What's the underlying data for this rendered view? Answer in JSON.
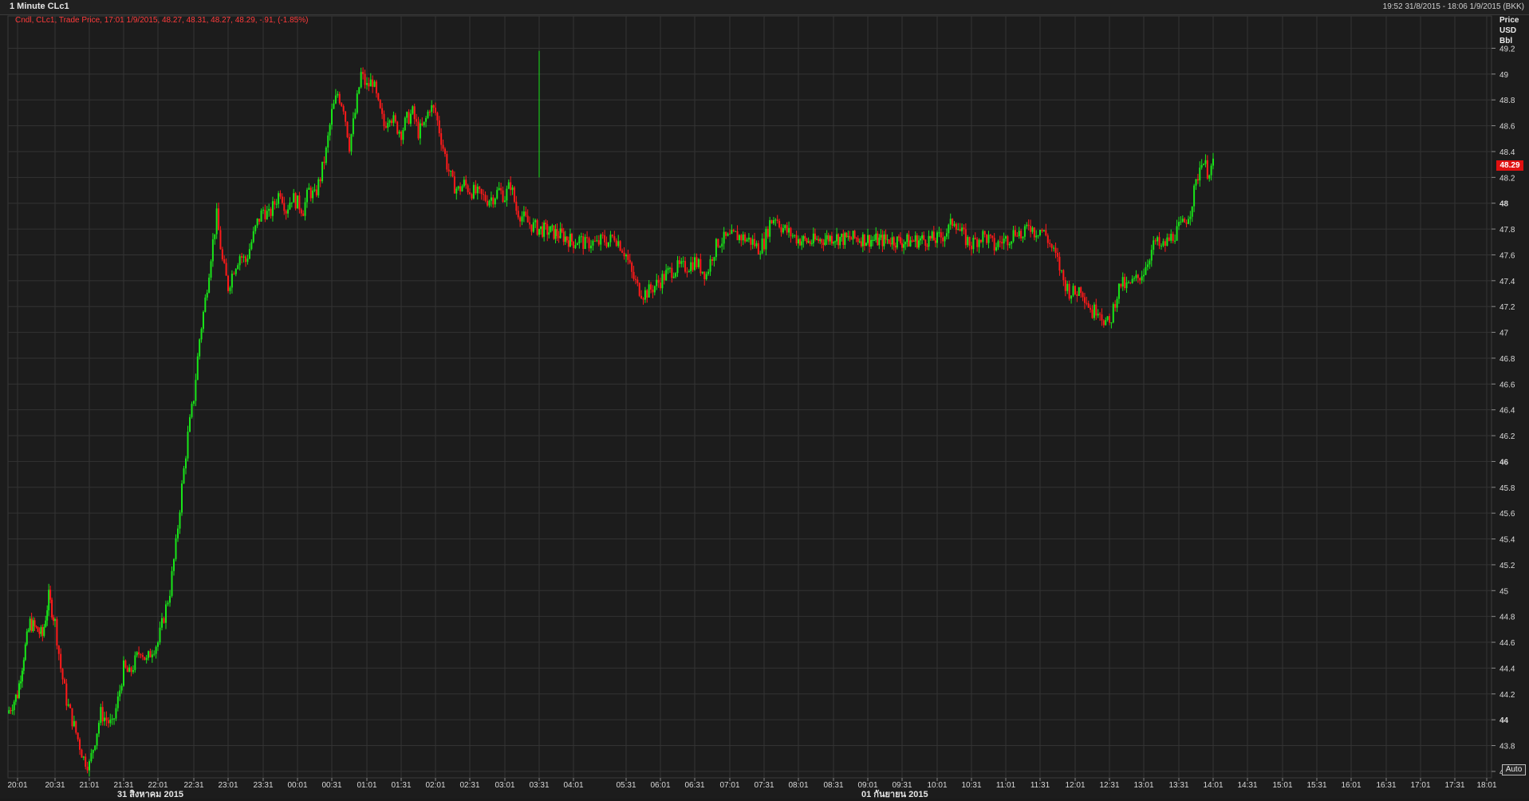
{
  "header": {
    "title": "1 Minute CLc1",
    "date_range": "19:52 31/8/2015 - 18:06 1/9/2015 (BKK)"
  },
  "legend": {
    "text": "Cndl, CLc1, Trade Price,  17:01 1/9/2015, 48.27, 48.31, 48.27, 48.29, -.91, (-1.85%)"
  },
  "price_axis": {
    "header_line1": "Price",
    "header_line2": "USD",
    "header_line3": "Bbl",
    "auto_label": "Auto",
    "last_price_label": "48.29"
  },
  "date_labels": {
    "first": "31 สิงหาคม 2015",
    "second": "01 กันยายน 2015"
  },
  "colors": {
    "up": "#19e619",
    "down": "#ff1a1a",
    "grid": "#333333",
    "background": "#1c1c1c",
    "last_price_tag": "#e01010"
  },
  "chart_data": {
    "type": "candlestick",
    "series_name": "CLc1",
    "interval": "1 Minute",
    "ylim": [
      43.55,
      49.45
    ],
    "y_ticks": [
      "43.6",
      "43.8",
      "44",
      "44.2",
      "44.4",
      "44.6",
      "44.8",
      "45",
      "45.2",
      "45.4",
      "45.6",
      "45.8",
      "46",
      "46.2",
      "46.4",
      "46.6",
      "46.8",
      "47",
      "47.2",
      "47.4",
      "47.6",
      "47.8",
      "48",
      "48.2",
      "48.4",
      "48.6",
      "48.8",
      "49",
      "49.2"
    ],
    "y_ticks_bold": [
      "44",
      "46",
      "48"
    ],
    "x_ticks": [
      "20:01",
      "20:31",
      "21:01",
      "21:31",
      "22:01",
      "22:31",
      "23:01",
      "23:31",
      "00:01",
      "00:31",
      "01:01",
      "01:31",
      "02:01",
      "02:31",
      "03:01",
      "03:31",
      "04:01",
      "05:31",
      "06:01",
      "06:31",
      "07:01",
      "07:31",
      "08:01",
      "08:31",
      "09:01",
      "09:31",
      "10:01",
      "10:31",
      "11:01",
      "11:31",
      "12:01",
      "12:31",
      "13:01",
      "13:31",
      "14:01",
      "14:31",
      "15:01",
      "15:31",
      "16:01",
      "16:31",
      "17:01",
      "17:31",
      "18:01"
    ],
    "close_path": [
      [
        "19:52",
        44.05
      ],
      [
        "20:01",
        44.2
      ],
      [
        "20:06",
        44.5
      ],
      [
        "20:11",
        44.75
      ],
      [
        "20:16",
        44.7
      ],
      [
        "20:21",
        44.65
      ],
      [
        "20:26",
        44.95
      ],
      [
        "20:31",
        44.75
      ],
      [
        "20:36",
        44.4
      ],
      [
        "20:41",
        44.15
      ],
      [
        "20:46",
        44.0
      ],
      [
        "20:51",
        43.85
      ],
      [
        "20:56",
        43.7
      ],
      [
        "21:01",
        43.65
      ],
      [
        "21:06",
        43.85
      ],
      [
        "21:11",
        44.05
      ],
      [
        "21:16",
        44.0
      ],
      [
        "21:21",
        43.95
      ],
      [
        "21:26",
        44.15
      ],
      [
        "21:31",
        44.4
      ],
      [
        "21:36",
        44.35
      ],
      [
        "21:41",
        44.45
      ],
      [
        "21:46",
        44.55
      ],
      [
        "21:51",
        44.45
      ],
      [
        "21:56",
        44.55
      ],
      [
        "22:01",
        44.6
      ],
      [
        "22:06",
        44.8
      ],
      [
        "22:11",
        45.0
      ],
      [
        "22:16",
        45.35
      ],
      [
        "22:21",
        45.8
      ],
      [
        "22:26",
        46.2
      ],
      [
        "22:31",
        46.5
      ],
      [
        "22:36",
        46.95
      ],
      [
        "22:41",
        47.25
      ],
      [
        "22:46",
        47.6
      ],
      [
        "22:51",
        47.9
      ],
      [
        "22:56",
        47.55
      ],
      [
        "23:01",
        47.35
      ],
      [
        "23:06",
        47.5
      ],
      [
        "23:11",
        47.6
      ],
      [
        "23:16",
        47.55
      ],
      [
        "23:21",
        47.7
      ],
      [
        "23:26",
        47.85
      ],
      [
        "23:31",
        47.95
      ],
      [
        "23:36",
        47.9
      ],
      [
        "23:41",
        48.0
      ],
      [
        "23:46",
        48.1
      ],
      [
        "23:51",
        47.95
      ],
      [
        "23:56",
        48.05
      ],
      [
        "00:01",
        48.0
      ],
      [
        "00:06",
        47.95
      ],
      [
        "00:11",
        48.1
      ],
      [
        "00:16",
        48.05
      ],
      [
        "00:21",
        48.2
      ],
      [
        "00:26",
        48.4
      ],
      [
        "00:31",
        48.7
      ],
      [
        "00:36",
        48.85
      ],
      [
        "00:41",
        48.75
      ],
      [
        "00:46",
        48.45
      ],
      [
        "00:51",
        48.7
      ],
      [
        "00:56",
        49.0
      ],
      [
        "01:01",
        48.9
      ],
      [
        "01:06",
        48.95
      ],
      [
        "01:11",
        48.75
      ],
      [
        "01:16",
        48.6
      ],
      [
        "01:21",
        48.7
      ],
      [
        "01:26",
        48.6
      ],
      [
        "01:31",
        48.55
      ],
      [
        "01:36",
        48.65
      ],
      [
        "01:41",
        48.7
      ],
      [
        "01:46",
        48.55
      ],
      [
        "01:51",
        48.6
      ],
      [
        "01:56",
        48.75
      ],
      [
        "02:01",
        48.7
      ],
      [
        "02:06",
        48.5
      ],
      [
        "02:11",
        48.3
      ],
      [
        "02:16",
        48.15
      ],
      [
        "02:21",
        48.1
      ],
      [
        "02:26",
        48.15
      ],
      [
        "02:31",
        48.1
      ],
      [
        "02:36",
        48.08
      ],
      [
        "02:41",
        48.05
      ],
      [
        "02:46",
        48.03
      ],
      [
        "02:51",
        48.05
      ],
      [
        "02:56",
        48.1
      ],
      [
        "03:01",
        48.05
      ],
      [
        "03:06",
        48.15
      ],
      [
        "03:11",
        47.95
      ],
      [
        "03:16",
        47.9
      ],
      [
        "03:21",
        47.85
      ],
      [
        "03:26",
        47.82
      ],
      [
        "03:31",
        47.8
      ],
      [
        "03:41",
        47.78
      ],
      [
        "03:51",
        47.75
      ],
      [
        "04:01",
        47.7
      ],
      [
        "04:11",
        47.72
      ],
      [
        "04:21",
        47.68
      ],
      [
        "04:31",
        47.7
      ],
      [
        "04:41",
        47.68
      ],
      [
        "04:51",
        47.72
      ],
      [
        "05:01",
        47.7
      ],
      [
        "05:11",
        47.75
      ],
      [
        "05:21",
        47.68
      ],
      [
        "05:31",
        47.6
      ],
      [
        "05:36",
        47.45
      ],
      [
        "05:41",
        47.35
      ],
      [
        "05:46",
        47.3
      ],
      [
        "05:51",
        47.32
      ],
      [
        "05:56",
        47.36
      ],
      [
        "06:01",
        47.4
      ],
      [
        "06:06",
        47.45
      ],
      [
        "06:11",
        47.48
      ],
      [
        "06:16",
        47.5
      ],
      [
        "06:21",
        47.5
      ],
      [
        "06:26",
        47.52
      ],
      [
        "06:31",
        47.55
      ],
      [
        "06:36",
        47.5
      ],
      [
        "06:41",
        47.45
      ],
      [
        "06:46",
        47.6
      ],
      [
        "06:51",
        47.7
      ],
      [
        "06:56",
        47.72
      ],
      [
        "07:01",
        47.73
      ],
      [
        "07:06",
        47.75
      ],
      [
        "07:11",
        47.74
      ],
      [
        "07:16",
        47.72
      ],
      [
        "07:21",
        47.7
      ],
      [
        "07:26",
        47.65
      ],
      [
        "07:31",
        47.7
      ],
      [
        "07:36",
        47.85
      ],
      [
        "07:41",
        47.9
      ],
      [
        "07:46",
        47.82
      ],
      [
        "07:51",
        47.78
      ],
      [
        "07:56",
        47.75
      ],
      [
        "08:01",
        47.72
      ],
      [
        "08:11",
        47.7
      ],
      [
        "08:21",
        47.72
      ],
      [
        "08:31",
        47.74
      ],
      [
        "08:41",
        47.72
      ],
      [
        "08:51",
        47.73
      ],
      [
        "09:01",
        47.72
      ],
      [
        "09:11",
        47.71
      ],
      [
        "09:21",
        47.72
      ],
      [
        "09:31",
        47.7
      ],
      [
        "09:41",
        47.71
      ],
      [
        "09:51",
        47.72
      ],
      [
        "10:01",
        47.72
      ],
      [
        "10:06",
        47.75
      ],
      [
        "10:11",
        47.8
      ],
      [
        "10:16",
        47.88
      ],
      [
        "10:21",
        47.78
      ],
      [
        "10:26",
        47.72
      ],
      [
        "10:31",
        47.68
      ],
      [
        "10:36",
        47.72
      ],
      [
        "10:41",
        47.75
      ],
      [
        "10:46",
        47.72
      ],
      [
        "10:51",
        47.66
      ],
      [
        "10:56",
        47.7
      ],
      [
        "11:01",
        47.72
      ],
      [
        "11:06",
        47.75
      ],
      [
        "11:11",
        47.8
      ],
      [
        "11:16",
        47.72
      ],
      [
        "11:21",
        47.85
      ],
      [
        "11:26",
        47.78
      ],
      [
        "11:31",
        47.8
      ],
      [
        "11:36",
        47.75
      ],
      [
        "11:41",
        47.65
      ],
      [
        "11:46",
        47.55
      ],
      [
        "11:51",
        47.4
      ],
      [
        "11:56",
        47.32
      ],
      [
        "12:01",
        47.3
      ],
      [
        "12:06",
        47.35
      ],
      [
        "12:11",
        47.25
      ],
      [
        "12:16",
        47.15
      ],
      [
        "12:21",
        47.2
      ],
      [
        "12:26",
        47.1
      ],
      [
        "12:31",
        47.05
      ],
      [
        "12:36",
        47.25
      ],
      [
        "12:41",
        47.38
      ],
      [
        "12:46",
        47.35
      ],
      [
        "12:51",
        47.38
      ],
      [
        "12:56",
        47.42
      ],
      [
        "13:01",
        47.48
      ],
      [
        "13:06",
        47.6
      ],
      [
        "13:11",
        47.7
      ],
      [
        "13:16",
        47.65
      ],
      [
        "13:21",
        47.7
      ],
      [
        "13:26",
        47.75
      ],
      [
        "13:31",
        47.8
      ],
      [
        "13:36",
        47.85
      ],
      [
        "13:41",
        47.95
      ],
      [
        "13:46",
        48.15
      ],
      [
        "13:51",
        48.35
      ],
      [
        "13:56",
        48.25
      ],
      [
        "14:01",
        48.29
      ]
    ],
    "last_price": 48.29,
    "spike": {
      "time": "03:31",
      "high": 49.18
    }
  }
}
